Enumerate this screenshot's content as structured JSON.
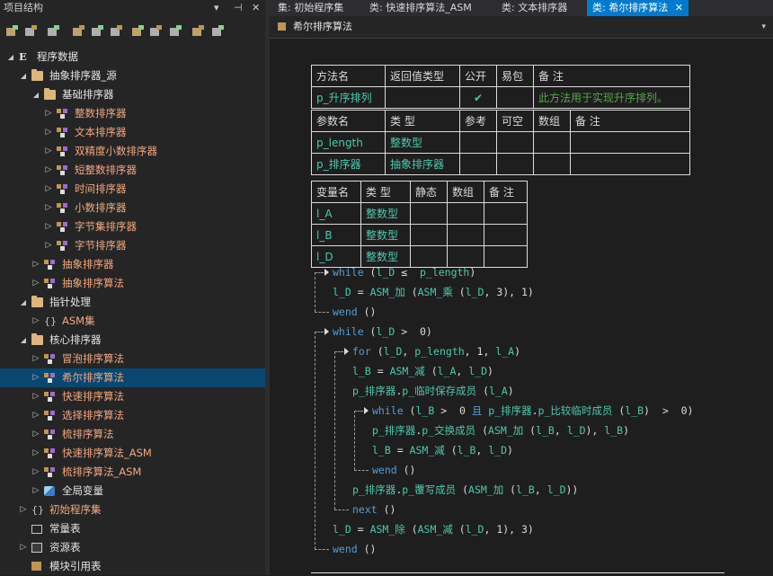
{
  "left_panel": {
    "title": "项目结构",
    "controls": [
      "▾",
      "⊣",
      "✕"
    ],
    "tree": [
      {
        "label": "程序数据",
        "icon": "E",
        "expanded": true,
        "indent": 0
      },
      {
        "label": "抽象排序器_源",
        "icon": "folder",
        "expanded": true,
        "indent": 1
      },
      {
        "label": "基础排序器",
        "icon": "folder",
        "expanded": true,
        "indent": 2
      },
      {
        "label": "整数排序器",
        "icon": "class",
        "expanded": false,
        "indent": 3,
        "color": "orange"
      },
      {
        "label": "文本排序器",
        "icon": "class",
        "expanded": false,
        "indent": 3,
        "color": "orange"
      },
      {
        "label": "双精度小数排序器",
        "icon": "class",
        "expanded": false,
        "indent": 3,
        "color": "orange"
      },
      {
        "label": "短整数排序器",
        "icon": "class",
        "expanded": false,
        "indent": 3,
        "color": "orange"
      },
      {
        "label": "时间排序器",
        "icon": "class",
        "expanded": false,
        "indent": 3,
        "color": "orange"
      },
      {
        "label": "小数排序器",
        "icon": "class",
        "expanded": false,
        "indent": 3,
        "color": "orange"
      },
      {
        "label": "字节集排序器",
        "icon": "class",
        "expanded": false,
        "indent": 3,
        "color": "orange"
      },
      {
        "label": "字节排序器",
        "icon": "class",
        "expanded": false,
        "indent": 3,
        "color": "orange"
      },
      {
        "label": "抽象排序器",
        "icon": "class",
        "expanded": false,
        "indent": 2,
        "color": "orange"
      },
      {
        "label": "抽象排序算法",
        "icon": "class",
        "expanded": false,
        "indent": 2,
        "color": "orange"
      },
      {
        "label": "指针处理",
        "icon": "folder",
        "expanded": true,
        "indent": 1
      },
      {
        "label": "ASM集",
        "icon": "brace",
        "expanded": false,
        "indent": 2,
        "color": "orange"
      },
      {
        "label": "核心排序器",
        "icon": "folder",
        "expanded": true,
        "indent": 1
      },
      {
        "label": "冒泡排序算法",
        "icon": "class",
        "expanded": false,
        "indent": 2,
        "color": "orange"
      },
      {
        "label": "希尔排序算法",
        "icon": "class",
        "expanded": false,
        "indent": 2,
        "color": "orange",
        "selected": true
      },
      {
        "label": "快速排序算法",
        "icon": "class",
        "expanded": false,
        "indent": 2,
        "color": "orange"
      },
      {
        "label": "选择排序算法",
        "icon": "class",
        "expanded": false,
        "indent": 2,
        "color": "orange"
      },
      {
        "label": "梳排序算法",
        "icon": "class",
        "expanded": false,
        "indent": 2,
        "color": "orange"
      },
      {
        "label": "快速排序算法_ASM",
        "icon": "class",
        "expanded": false,
        "indent": 2,
        "color": "orange"
      },
      {
        "label": "梳排序算法_ASM",
        "icon": "class",
        "expanded": false,
        "indent": 2,
        "color": "orange"
      },
      {
        "label": "全局变量",
        "icon": "global",
        "expanded": false,
        "indent": 2
      },
      {
        "label": "初始程序集",
        "icon": "brace",
        "expanded": false,
        "indent": 1,
        "color": "orange"
      },
      {
        "label": "常量表",
        "icon": "const",
        "expanded": null,
        "indent": 1
      },
      {
        "label": "资源表",
        "icon": "resource",
        "expanded": false,
        "indent": 1
      },
      {
        "label": "模块引用表",
        "icon": "module",
        "expanded": null,
        "indent": 1
      }
    ]
  },
  "tabs": [
    {
      "label": "集: 初始程序集",
      "active": false
    },
    {
      "label": "类: 快速排序算法_ASM",
      "active": false
    },
    {
      "label": "类: 文本排序器",
      "active": false
    },
    {
      "label": "类: 希尔排序算法",
      "active": true,
      "close": "✕"
    }
  ],
  "subheader": {
    "title": "希尔排序算法",
    "dropdown": "▾"
  },
  "method_table": {
    "headers": [
      "方法名",
      "返回值类型",
      "公开",
      "易包",
      "备 注"
    ],
    "row": {
      "name": "p_升序排列",
      "return_type": "",
      "public": "✔",
      "easy": "",
      "remark": "此方法用于实现升序排列。"
    },
    "param_headers": [
      "参数名",
      "类 型",
      "参考",
      "可空",
      "数组",
      "备 注"
    ],
    "params": [
      {
        "name": "p_length",
        "type": "整数型"
      },
      {
        "name": "p_排序器",
        "type": "抽象排序器"
      }
    ]
  },
  "var_table": {
    "headers": [
      "变量名",
      "类 型",
      "静态",
      "数组",
      "备 注"
    ],
    "vars": [
      {
        "name": "l_A",
        "type": "整数型"
      },
      {
        "name": "l_B",
        "type": "整数型"
      },
      {
        "name": "l_D",
        "type": "整数型"
      }
    ]
  },
  "code": [
    {
      "id": "c0",
      "parts": [
        [
          "kw",
          "while"
        ],
        [
          "",
          " ("
        ],
        [
          "id",
          "l_D"
        ],
        [
          "",
          " ≤  "
        ],
        [
          "id",
          "p_length"
        ],
        [
          "",
          ")"
        ]
      ]
    },
    {
      "id": "c1",
      "parts": [
        [
          "id",
          "l_D"
        ],
        [
          "",
          " = "
        ],
        [
          "id",
          "ASM_加"
        ],
        [
          "",
          " ("
        ],
        [
          "id",
          "ASM_乘"
        ],
        [
          "",
          " ("
        ],
        [
          "id",
          "l_D"
        ],
        [
          "",
          ", 3), 1)"
        ]
      ]
    },
    {
      "id": "c2",
      "parts": [
        [
          "kw",
          "wend"
        ],
        [
          "",
          " ()"
        ]
      ]
    },
    {
      "id": "c3",
      "parts": [
        [
          "kw",
          "while"
        ],
        [
          "",
          " ("
        ],
        [
          "id",
          "l_D"
        ],
        [
          "",
          " >  0)"
        ]
      ]
    },
    {
      "id": "c4",
      "parts": [
        [
          "kw",
          "for"
        ],
        [
          "",
          " ("
        ],
        [
          "id",
          "l_D"
        ],
        [
          "",
          ", "
        ],
        [
          "id",
          "p_length"
        ],
        [
          "",
          ", 1, "
        ],
        [
          "id",
          "l_A"
        ],
        [
          "",
          ")"
        ]
      ]
    },
    {
      "id": "c5",
      "parts": [
        [
          "id",
          "l_B"
        ],
        [
          "",
          " = "
        ],
        [
          "id",
          "ASM_减"
        ],
        [
          "",
          " ("
        ],
        [
          "id",
          "l_A"
        ],
        [
          "",
          ", "
        ],
        [
          "id",
          "l_D"
        ],
        [
          "",
          ")"
        ]
      ]
    },
    {
      "id": "c6",
      "parts": [
        [
          "id",
          "p_排序器"
        ],
        [
          "",
          "."
        ],
        [
          "id",
          "p_临时保存成员"
        ],
        [
          "",
          " ("
        ],
        [
          "id",
          "l_A"
        ],
        [
          "",
          ")"
        ]
      ]
    },
    {
      "id": "c7",
      "parts": [
        [
          "kw",
          "while"
        ],
        [
          "",
          " ("
        ],
        [
          "id",
          "l_B"
        ],
        [
          "",
          " >  0 "
        ],
        [
          "kw",
          "且"
        ],
        [
          "",
          " "
        ],
        [
          "id",
          "p_排序器"
        ],
        [
          "",
          "."
        ],
        [
          "id",
          "p_比较临时成员"
        ],
        [
          "",
          " ("
        ],
        [
          "id",
          "l_B"
        ],
        [
          "",
          ")  >  0)"
        ]
      ]
    },
    {
      "id": "c8",
      "parts": [
        [
          "id",
          "p_排序器"
        ],
        [
          "",
          "."
        ],
        [
          "id",
          "p_交换成员"
        ],
        [
          "",
          " ("
        ],
        [
          "id",
          "ASM_加"
        ],
        [
          "",
          " ("
        ],
        [
          "id",
          "l_B"
        ],
        [
          "",
          ", "
        ],
        [
          "id",
          "l_D"
        ],
        [
          "",
          "), "
        ],
        [
          "id",
          "l_B"
        ],
        [
          "",
          ")"
        ]
      ]
    },
    {
      "id": "c9",
      "parts": [
        [
          "id",
          "l_B"
        ],
        [
          "",
          " = "
        ],
        [
          "id",
          "ASM_减"
        ],
        [
          "",
          " ("
        ],
        [
          "id",
          "l_B"
        ],
        [
          "",
          ", "
        ],
        [
          "id",
          "l_D"
        ],
        [
          "",
          ")"
        ]
      ]
    },
    {
      "id": "c10",
      "parts": [
        [
          "kw",
          "wend"
        ],
        [
          "",
          " ()"
        ]
      ]
    },
    {
      "id": "c11",
      "parts": [
        [
          "id",
          "p_排序器"
        ],
        [
          "",
          "."
        ],
        [
          "id",
          "p_覆写成员"
        ],
        [
          "",
          " ("
        ],
        [
          "id",
          "ASM_加"
        ],
        [
          "",
          " ("
        ],
        [
          "id",
          "l_B"
        ],
        [
          "",
          ", "
        ],
        [
          "id",
          "l_D"
        ],
        [
          "",
          "))"
        ]
      ]
    },
    {
      "id": "c12",
      "parts": [
        [
          "kw",
          "next"
        ],
        [
          "",
          " ()"
        ]
      ]
    },
    {
      "id": "c13",
      "parts": [
        [
          "id",
          "l_D"
        ],
        [
          "",
          " = "
        ],
        [
          "id",
          "ASM_除"
        ],
        [
          "",
          " ("
        ],
        [
          "id",
          "ASM_减"
        ],
        [
          "",
          " ("
        ],
        [
          "id",
          "l_D"
        ],
        [
          "",
          ", 1), 3)"
        ]
      ]
    },
    {
      "id": "c14",
      "parts": [
        [
          "kw",
          "wend"
        ],
        [
          "",
          " ()"
        ]
      ]
    }
  ]
}
